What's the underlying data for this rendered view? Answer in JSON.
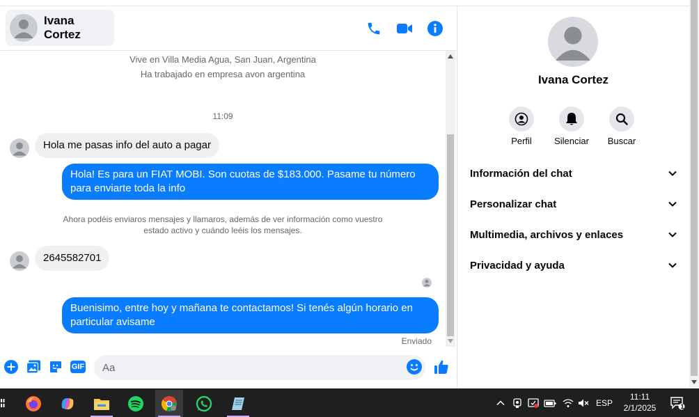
{
  "header": {
    "contact_name": "Ivana Cortez"
  },
  "messages": {
    "info_location": "Vive en Villa Media Agua, San Juan, Argentina",
    "info_work": "Ha trabajado en empresa avon argentina",
    "timestamp": "11:09",
    "msg1": "Hola me pasas info del auto a pagar",
    "msg2": "Hola! Es para un FIAT MOBI. Son cuotas de $183.000. Pasame tu número para enviarte toda la info",
    "system_note": "Ahora podéis enviaros mensajes y llamaros, además de ver información como vuestro estado activo y cuándo leéis los mensajes.",
    "msg3": "2645582701",
    "msg4": "Buenisimo, entre hoy y mañana te contactamos! Si tenés algún horario en particular avisame",
    "status": "Enviado"
  },
  "composer": {
    "placeholder": "Aa",
    "gif_label": "GIF"
  },
  "right_panel": {
    "name": "Ivana Cortez",
    "actions": [
      {
        "label": "Perfil"
      },
      {
        "label": "Silenciar"
      },
      {
        "label": "Buscar"
      }
    ],
    "sections": [
      {
        "label": "Información del chat"
      },
      {
        "label": "Personalizar chat"
      },
      {
        "label": "Multimedia, archivos y enlaces"
      },
      {
        "label": "Privacidad y ayuda"
      }
    ]
  },
  "taskbar": {
    "language": "ESP",
    "time": "11:11",
    "date": "2/1/2025",
    "notification_count": "1"
  },
  "colors": {
    "accent": "#0a7cff",
    "bubble_in": "#f0f0f0"
  }
}
